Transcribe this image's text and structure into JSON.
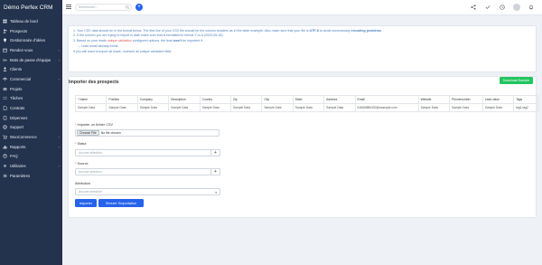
{
  "brand": "Démo Perfex CRM",
  "sidebar": {
    "items": [
      {
        "label": "Tableau de bord",
        "icon": "dashboard-icon",
        "chevron": false
      },
      {
        "label": "Prospects",
        "icon": "user-plus-icon",
        "chevron": false
      },
      {
        "label": "Gestionnaire d'idées",
        "icon": "lightbulb-icon",
        "chevron": false
      },
      {
        "label": "Rendez-vous",
        "icon": "calendar-icon",
        "chevron": true
      },
      {
        "label": "Mots de passe d'équipe",
        "icon": "key-icon",
        "chevron": true
      },
      {
        "label": "Clients",
        "icon": "user-icon",
        "chevron": false
      },
      {
        "label": "Commercial",
        "icon": "balance-scale-icon",
        "chevron": true
      },
      {
        "label": "Projets",
        "icon": "bars-icon",
        "chevron": false
      },
      {
        "label": "Tâches",
        "icon": "tasks-icon",
        "chevron": false
      },
      {
        "label": "Contrats",
        "icon": "file-icon",
        "chevron": false
      },
      {
        "label": "Dépenses",
        "icon": "receipt-icon",
        "chevron": false
      },
      {
        "label": "Support",
        "icon": "life-ring-icon",
        "chevron": false
      },
      {
        "label": "WooCommerce",
        "icon": "cart-icon",
        "chevron": true
      },
      {
        "label": "Rapports",
        "icon": "chart-icon",
        "chevron": true
      },
      {
        "label": "FAQ",
        "icon": "question-icon",
        "chevron": false
      },
      {
        "label": "Utilitaires",
        "icon": "cogs-icon",
        "chevron": true
      },
      {
        "label": "Paramètres",
        "icon": "gear-icon",
        "chevron": false
      }
    ]
  },
  "header": {
    "search_placeholder": "Rechercher..."
  },
  "info": {
    "line1_a": "1. Your CSV data should be in the format below. The first line of your CSV file should be the column headers as in the table example. Also make sure that your file is ",
    "line1_b": "UTF-8",
    "line1_c": " to avoid unnecessary ",
    "line1_d": "encoding problems",
    "line1_e": ".",
    "line2": "2. If the column you are trying to import is date make sure that is formatted in format Y-m-d (2023-05-18).",
    "line3_a": "3. Based on your leads ",
    "line3_b": "unique validation",
    "line3_c": " configured options, the lead ",
    "line3_d": "won't",
    "line3_e": " be imported if:",
    "line4": "– Lead email already exists",
    "line5": "If you still want to import all leads, uncheck all unique validation field"
  },
  "panel": {
    "title": "Importer des prospects",
    "download_label": "Download Sample",
    "columns": [
      "* Name",
      "Position",
      "Company",
      "Description",
      "Country",
      "Zip",
      "City",
      "State",
      "Address",
      "Email",
      "Website",
      "Phonenumber",
      "Lead value",
      "Tags"
    ],
    "row": [
      "Sample Data",
      "Sample Data",
      "Sample Data",
      "Sample Data",
      "Sample Data",
      "Sample Data",
      "Sample Data",
      "Sample Data",
      "Sample Data",
      "6166f4f8fb330@example.com",
      "Sample Data",
      "Sample Data",
      "Sample Data",
      "tag1,tag2"
    ],
    "file_label": "Importer un fichier CSV",
    "choose_label": "Choose File",
    "no_file": "No file chosen",
    "status_label": "Statut",
    "status_placeholder": "Aucune sélection",
    "source_label": "Source",
    "source_placeholder": "Aucune sélection",
    "assign_label": "Attribution",
    "assign_placeholder": "Aucune sélection",
    "import_btn": "Importer",
    "simulate_btn": "Simuler l'importation"
  }
}
